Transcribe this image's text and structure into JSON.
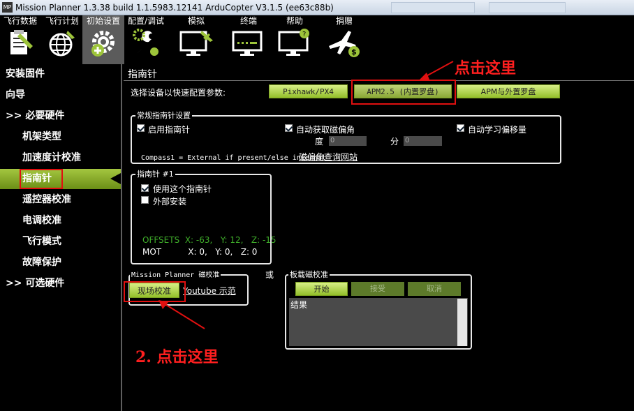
{
  "window": {
    "title": "Mission Planner 1.3.38 build 1.1.5983.12141 ArduCopter V3.1.5 (ee63c88b)",
    "app_icon_text": "MP"
  },
  "toolbar": {
    "items": [
      {
        "label": "飞行数据",
        "icon": "clipboard-icon"
      },
      {
        "label": "飞行计划",
        "icon": "globe-icon"
      },
      {
        "label": "初始设置",
        "icon": "gear-plus-icon"
      },
      {
        "label": "配置/调试",
        "icon": "wrench-icon"
      },
      {
        "label": "模拟",
        "icon": "monitor-plane-icon"
      },
      {
        "label": "终端",
        "icon": "terminal-icon"
      },
      {
        "label": "帮助",
        "icon": "help-monitor-icon"
      },
      {
        "label": "捐赠",
        "icon": "plane-dollar-icon"
      }
    ]
  },
  "sidebar": {
    "items": [
      {
        "label": "安装固件"
      },
      {
        "label": "向导"
      },
      {
        "label": ">> 必要硬件"
      },
      {
        "label": "机架类型"
      },
      {
        "label": "加速度计校准"
      },
      {
        "label": "指南针"
      },
      {
        "label": "遥控器校准"
      },
      {
        "label": "电调校准"
      },
      {
        "label": "飞行模式"
      },
      {
        "label": "故障保护"
      },
      {
        "label": ">> 可选硬件"
      }
    ],
    "active_index": 5
  },
  "main": {
    "title": "指南针",
    "select_label": "选择设备以快速配置参数:",
    "presets": [
      "Pixhawk/PX4",
      "APM2.5 (内置罗盘)",
      "APM与外置罗盘"
    ],
    "general": {
      "title": "常规指南针设置",
      "enable_compass": "启用指南针",
      "auto_declination": "自动获取磁偏角",
      "auto_learn": "自动学习偏移量",
      "degree_label": "度",
      "degree_value": "0",
      "minute_label": "分",
      "minute_value": "0",
      "website_link": "磁偏角查询网站",
      "compass_note": "Compass1 = External if present/else internal"
    },
    "compass1": {
      "title": "指南针 #1",
      "use_this": "使用这个指南针",
      "external": "外部安装",
      "offsets": "OFFSETS  X: -63,   Y: 12,   Z: -15",
      "mot": "MOT          X: 0,   Y: 0,   Z: 0"
    },
    "mp_calib": {
      "title": "Mission Planner 磁校准",
      "live_button": "现场校准",
      "youtube_link": "Youtube 示范"
    },
    "or_label": "或",
    "onboard": {
      "title": "板载磁校准",
      "start": "开始",
      "accept": "接受",
      "cancel": "取消",
      "result_label": "结果"
    }
  },
  "annotations": {
    "click_here_1": "点击这里",
    "click_here_2": "2. 点击这里"
  },
  "colors": {
    "accent_green": "#93bf2a",
    "annotation_red": "#e01010",
    "offsets_green": "#3fae2a"
  }
}
